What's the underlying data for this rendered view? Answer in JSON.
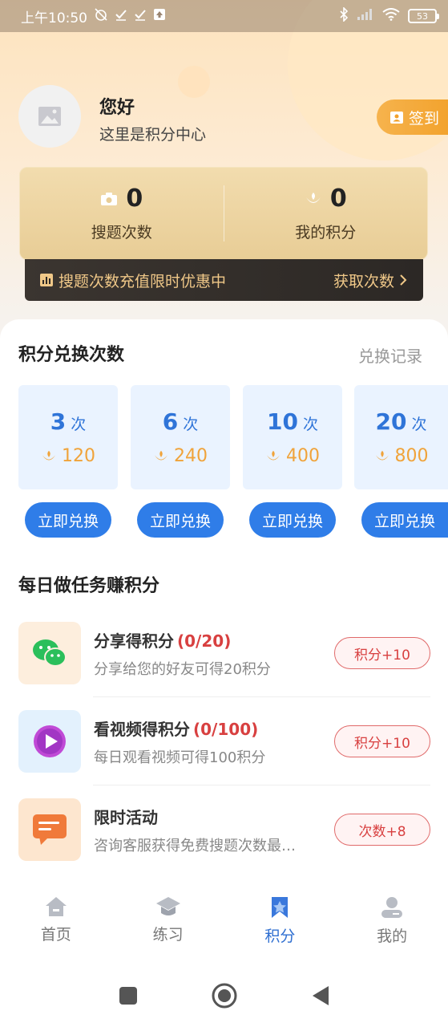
{
  "status_bar": {
    "time": "上午10:50",
    "battery": "53"
  },
  "profile": {
    "greeting": "您好",
    "subtitle": "这里是积分中心",
    "signin_label": "签到"
  },
  "stats": {
    "search_count": "0",
    "search_label": "搜题次数",
    "points": "0",
    "points_label": "我的积分"
  },
  "promo": {
    "text": "搜题次数充值限时优惠中",
    "action": "获取次数"
  },
  "exchange": {
    "title": "积分兑换次数",
    "record_link": "兑换记录",
    "packages": [
      {
        "count": "3",
        "unit": "次",
        "cost": "120",
        "button": "立即兑换"
      },
      {
        "count": "6",
        "unit": "次",
        "cost": "240",
        "button": "立即兑换"
      },
      {
        "count": "10",
        "unit": "次",
        "cost": "400",
        "button": "立即兑换"
      },
      {
        "count": "20",
        "unit": "次",
        "cost": "800",
        "button": "立即兑换"
      }
    ]
  },
  "tasks": {
    "title": "每日做任务赚积分",
    "items": [
      {
        "title": "分享得积分",
        "progress": "(0/20)",
        "desc": "分享给您的好友可得20积分",
        "badge": "积分+10",
        "icon": "wechat-icon",
        "icon_bg": "#fdeedd"
      },
      {
        "title": "看视频得积分",
        "progress": "(0/100)",
        "desc": "每日观看视频可得100积分",
        "badge": "积分+10",
        "icon": "play-icon",
        "icon_bg": "#e3f1fd"
      },
      {
        "title": "限时活动",
        "progress": "",
        "desc": "咨询客服获得免费搜题次数最…",
        "badge": "次数+8",
        "icon": "chat-icon",
        "icon_bg": "#fde6cf"
      }
    ]
  },
  "tabbar": {
    "items": [
      {
        "label": "首页",
        "icon": "home-icon"
      },
      {
        "label": "练习",
        "icon": "graduation-cap-icon"
      },
      {
        "label": "积分",
        "icon": "points-icon",
        "active": true
      },
      {
        "label": "我的",
        "icon": "profile-icon"
      }
    ]
  },
  "colors": {
    "accent_blue": "#2f7de8",
    "gold": "#f0a33a",
    "red": "#d84040"
  }
}
